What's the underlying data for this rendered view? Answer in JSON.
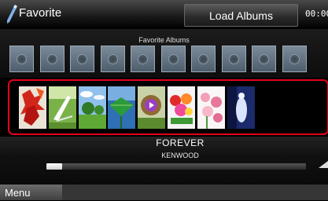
{
  "header": {
    "title": "Favorite",
    "title_icon": "pencil-icon",
    "load_button_label": "Load Albums",
    "clock": "00:00"
  },
  "favorites": {
    "label": "Favorite Albums",
    "empty_slot_count": 10
  },
  "artwork_strip": {
    "highlight_color": "#e3001b",
    "items": [
      {
        "name": "album-art-red-leaves"
      },
      {
        "name": "album-art-beach-chair"
      },
      {
        "name": "album-art-meadow-trees"
      },
      {
        "name": "album-art-green-leaf"
      },
      {
        "name": "album-art-purple-flower",
        "selected": true
      },
      {
        "name": "album-art-rose-bouquet"
      },
      {
        "name": "album-art-pink-flowers"
      },
      {
        "name": "album-art-blue-figure"
      }
    ]
  },
  "now_playing": {
    "track": "FOREVER",
    "artist": "KENWOOD",
    "progress": 0.06
  },
  "footer": {
    "menu_label": "Menu"
  }
}
